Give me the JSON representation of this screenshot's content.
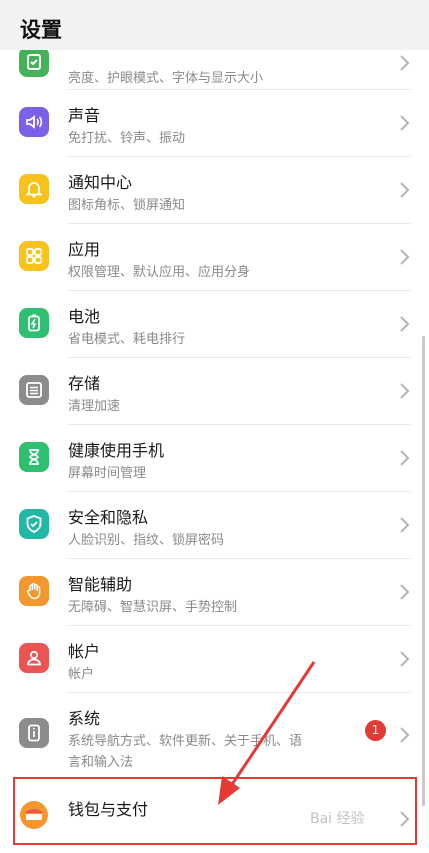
{
  "header": {
    "title": "设置"
  },
  "items": [
    {
      "title": "",
      "sub": "亮度、护眼模式、字体与显示大小",
      "color": "#43b35a",
      "icon": "display-icon"
    },
    {
      "title": "声音",
      "sub": "免打扰、铃声、振动",
      "color": "#7b61e8",
      "icon": "speaker-icon"
    },
    {
      "title": "通知中心",
      "sub": "图标角标、锁屏通知",
      "color": "#f6c21b",
      "icon": "bell-icon"
    },
    {
      "title": "应用",
      "sub": "权限管理、默认应用、应用分身",
      "color": "#f6c21b",
      "icon": "apps-grid-icon"
    },
    {
      "title": "电池",
      "sub": "省电模式、耗电排行",
      "color": "#2fbf71",
      "icon": "battery-icon"
    },
    {
      "title": "存储",
      "sub": "清理加速",
      "color": "#8c8c8c",
      "icon": "storage-icon"
    },
    {
      "title": "健康使用手机",
      "sub": "屏幕时间管理",
      "color": "#2fbf71",
      "icon": "hourglass-icon"
    },
    {
      "title": "安全和隐私",
      "sub": "人脸识别、指纹、锁屏密码",
      "color": "#23b8a6",
      "icon": "shield-icon"
    },
    {
      "title": "智能辅助",
      "sub": "无障碍、智慧识屏、手势控制",
      "color": "#f3972e",
      "icon": "hand-icon"
    },
    {
      "title": "帐户",
      "sub": "帐户",
      "color": "#ec5353",
      "icon": "user-icon"
    },
    {
      "title": "系统",
      "sub": "系统导航方式、软件更新、关于手机、语",
      "sub2": "言和输入法",
      "badge": "1",
      "color": "#8c8c8c",
      "icon": "phone-info-icon"
    },
    {
      "title": "钱包与支付",
      "sub": "",
      "color": "#f3972e",
      "icon": "wallet-icon"
    }
  ],
  "watermark": "Bai 经验"
}
